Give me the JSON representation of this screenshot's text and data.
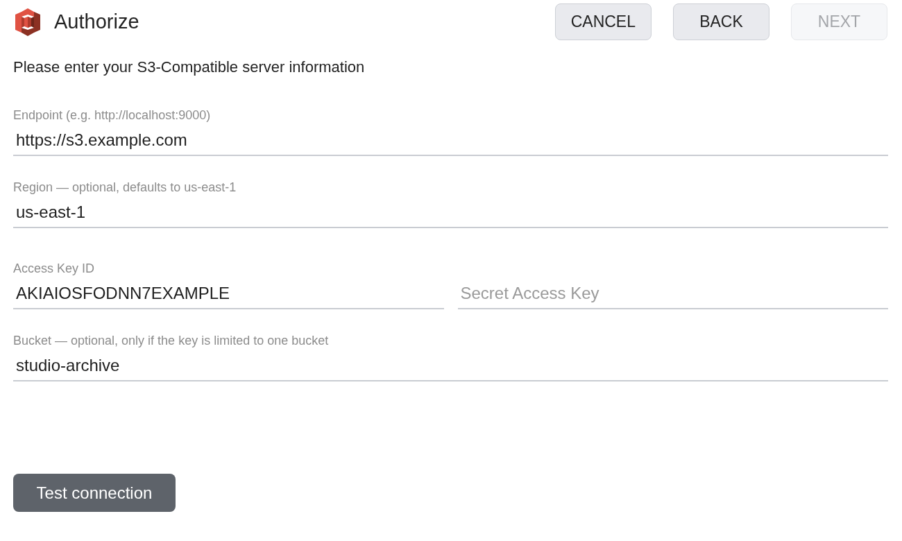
{
  "header": {
    "title": "Authorize",
    "buttons": [
      {
        "label": "CANCEL",
        "disabled": false
      },
      {
        "label": "BACK",
        "disabled": false
      },
      {
        "label": "NEXT",
        "disabled": true
      }
    ]
  },
  "instructions": "Please enter your S3-Compatible server information",
  "form_rows": [
    {
      "fields": [
        {
          "label": "Endpoint (e.g. http://localhost:9000)",
          "value": "https://s3.example.com"
        }
      ]
    },
    {
      "fields": [
        {
          "label": "Region — optional, defaults to us-east-1",
          "value": "us-east-1"
        }
      ]
    },
    {
      "fields": [
        {
          "label": "Access Key ID",
          "value": "AKIAIOSFODNN7EXAMPLE"
        },
        {
          "placeholder": "Secret Access Key"
        }
      ]
    },
    {
      "fields": [
        {
          "label": "Bucket — optional, only if the key is limited to one bucket",
          "value": "studio-archive"
        }
      ]
    }
  ],
  "test_button": {
    "label": "Test connection"
  }
}
